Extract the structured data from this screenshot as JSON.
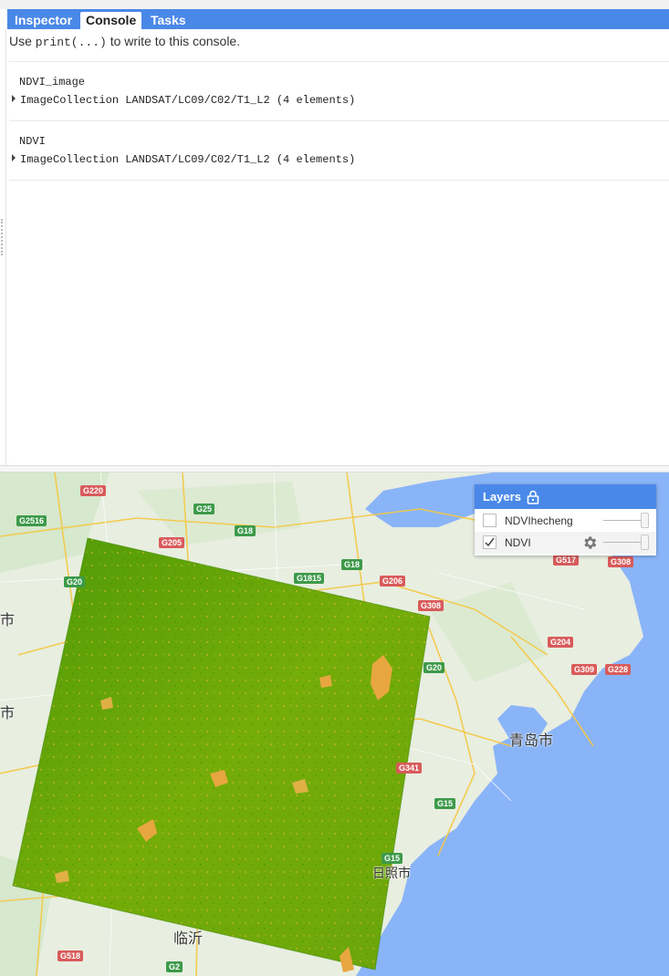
{
  "tabs": [
    {
      "label": "Inspector",
      "active": false
    },
    {
      "label": "Console",
      "active": true
    },
    {
      "label": "Tasks",
      "active": false
    }
  ],
  "console": {
    "hint_prefix": "Use",
    "hint_code": "print(...)",
    "hint_suffix": "to write to this console.",
    "entries": [
      {
        "label": "NDVI_image",
        "value": "ImageCollection LANDSAT/LC09/C02/T1_L2 (4 elements)"
      },
      {
        "label": "NDVI",
        "value": "ImageCollection LANDSAT/LC09/C02/T1_L2 (4 elements)"
      }
    ]
  },
  "layers": {
    "title": "Layers",
    "items": [
      {
        "name": "NDVIhecheng",
        "checked": false
      },
      {
        "name": "NDVI",
        "checked": true
      }
    ]
  },
  "map": {
    "cities": [
      "青岛市",
      "日照市",
      "临沂",
      "市",
      "市"
    ],
    "highway_shields": [
      "G220",
      "G25",
      "G2516",
      "G18",
      "G205",
      "G18",
      "G1815",
      "G206",
      "G308",
      "G20",
      "G204",
      "G309",
      "G228",
      "G517",
      "G308",
      "G341",
      "G15",
      "G15",
      "G518",
      "G2",
      "G20"
    ],
    "colors": {
      "sea": "#8ab4f8",
      "land": "#e8eee0",
      "ndvi_high": "#5a9e08",
      "ndvi_low": "#e8a640",
      "accent": "#4a88e8"
    }
  }
}
